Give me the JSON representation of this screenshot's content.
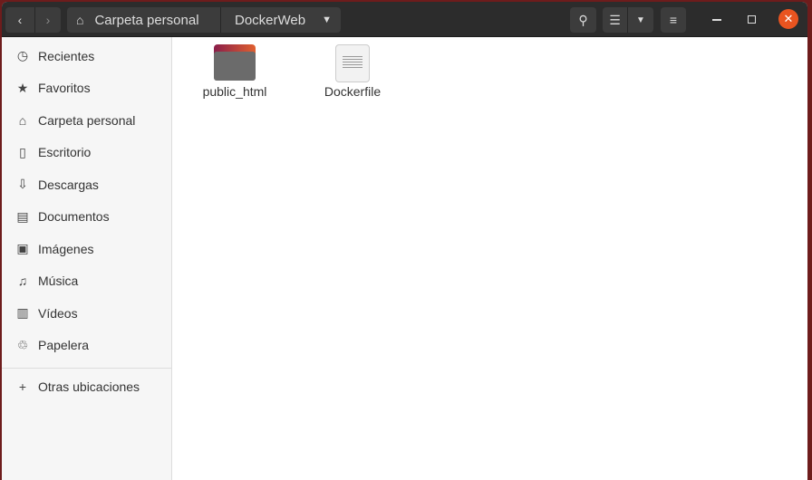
{
  "header": {
    "path": [
      "Carpeta personal",
      "DockerWeb"
    ]
  },
  "sidebar": {
    "items": [
      {
        "label": "Recientes",
        "icon": "clock-icon"
      },
      {
        "label": "Favoritos",
        "icon": "star-icon"
      },
      {
        "label": "Carpeta personal",
        "icon": "home-icon"
      },
      {
        "label": "Escritorio",
        "icon": "desktop-icon"
      },
      {
        "label": "Descargas",
        "icon": "download-icon"
      },
      {
        "label": "Documentos",
        "icon": "document-icon"
      },
      {
        "label": "Imágenes",
        "icon": "image-icon"
      },
      {
        "label": "Música",
        "icon": "music-icon"
      },
      {
        "label": "Vídeos",
        "icon": "video-icon"
      },
      {
        "label": "Papelera",
        "icon": "trash-icon"
      }
    ],
    "other": "Otras ubicaciones"
  },
  "files": [
    {
      "name": "public_html",
      "type": "folder"
    },
    {
      "name": "Dockerfile",
      "type": "file"
    }
  ],
  "colors": {
    "close": "#e95420",
    "header": "#2c2c2c"
  }
}
